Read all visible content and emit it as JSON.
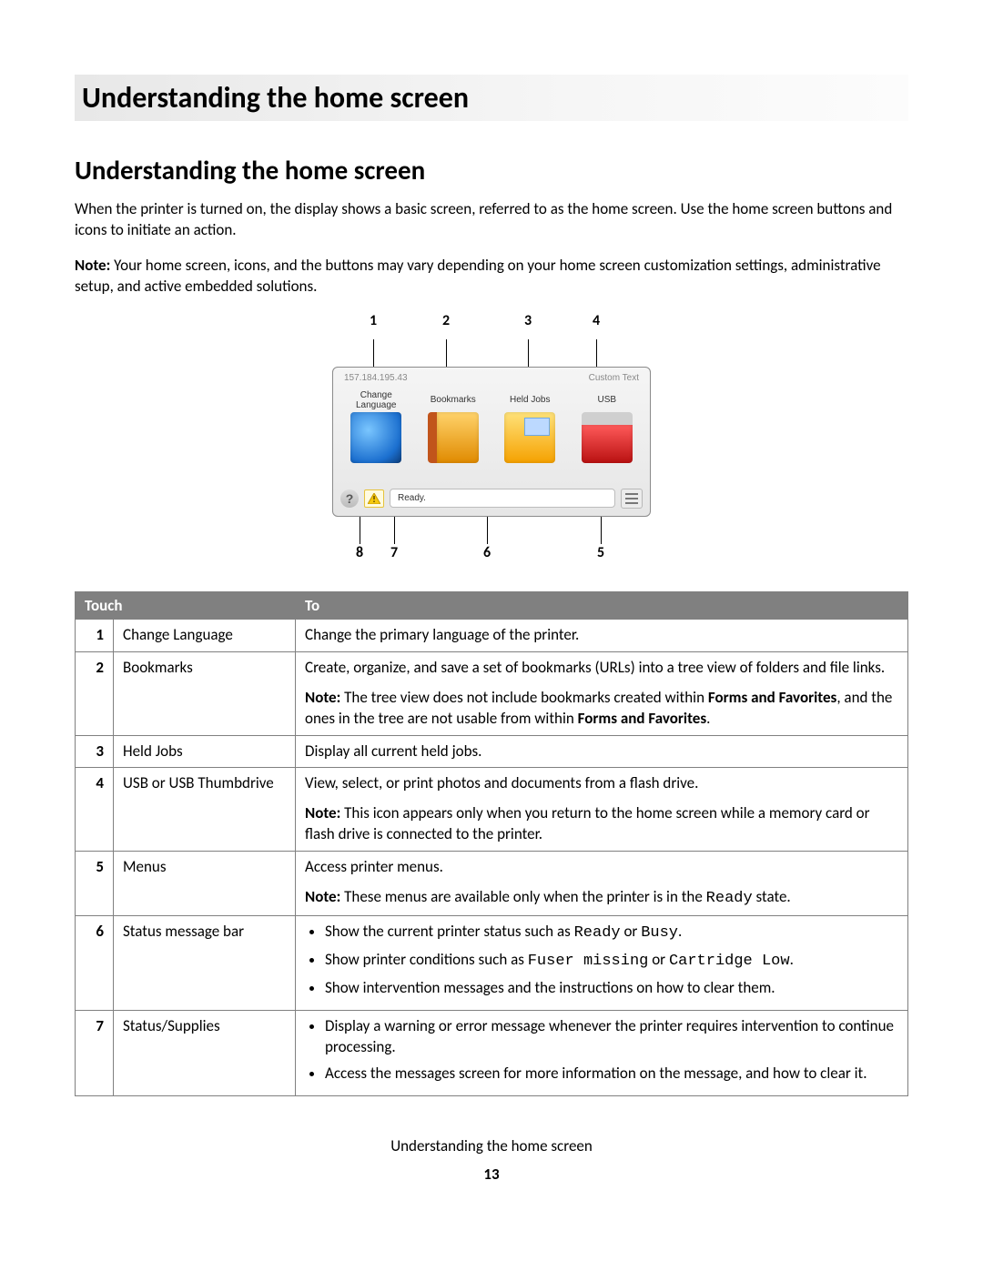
{
  "chapter_title": "Understanding the home screen",
  "section_title": "Understanding the home screen",
  "intro_para": "When the printer is turned on, the display shows a basic screen, referred to as the home screen. Use the home screen buttons and icons to initiate an action.",
  "note_prefix": "Note:",
  "note_para": " Your home screen, icons, and the buttons may vary depending on your home screen customization settings, administrative setup, and active embedded solutions.",
  "callouts_top": {
    "c1": "1",
    "c2": "2",
    "c3": "3",
    "c4": "4"
  },
  "callouts_bot": {
    "c5": "5",
    "c6": "6",
    "c7": "7",
    "c8": "8"
  },
  "device": {
    "ip": "157.184.195.43",
    "custom_text": "Custom Text",
    "items": {
      "change_language": "Change Language",
      "bookmarks": "Bookmarks",
      "held_jobs": "Held Jobs",
      "usb": "USB"
    },
    "status_ready": "Ready.",
    "help_glyph": "?"
  },
  "table": {
    "head_touch": "Touch",
    "head_to": "To",
    "rows": {
      "r1": {
        "num": "1",
        "name": "Change Language",
        "desc": "Change the primary language of the printer."
      },
      "r2": {
        "num": "2",
        "name": "Bookmarks",
        "desc1": "Create, organize, and save a set of bookmarks (URLs) into a tree view of folders and file links.",
        "note_lead": "Note:",
        "note_a": " The tree view does not include bookmarks created within ",
        "ff1": "Forms and Favorites",
        "note_b": ", and the ones in the tree are not usable from within ",
        "ff2": "Forms and Favorites",
        "note_c": "."
      },
      "r3": {
        "num": "3",
        "name": "Held Jobs",
        "desc": "Display all current held jobs."
      },
      "r4": {
        "num": "4",
        "name": "USB or USB Thumbdrive",
        "desc1": "View, select, or print photos and documents from a flash drive.",
        "note_lead": "Note:",
        "note_rest": " This icon appears only when you return to the home screen while a memory card or flash drive is connected to the printer."
      },
      "r5": {
        "num": "5",
        "name": "Menus",
        "desc1": "Access printer menus.",
        "note_lead": "Note:",
        "note_a": " These menus are available only when the printer is in the ",
        "ready": "Ready",
        "note_b": " state."
      },
      "r6": {
        "num": "6",
        "name": "Status message bar",
        "b1a": "Show the current printer status such as ",
        "b1_ready": "Ready",
        "b1_or": " or ",
        "b1_busy": "Busy",
        "b1_end": ".",
        "b2a": "Show printer conditions such as ",
        "b2_fuser": "Fuser missing",
        "b2_or": " or ",
        "b2_cart": "Cartridge Low",
        "b2_end": ".",
        "b3": "Show intervention messages and the instructions on how to clear them."
      },
      "r7": {
        "num": "7",
        "name": "Status/Supplies",
        "b1": "Display a warning or error message whenever the printer requires intervention to continue processing.",
        "b2": "Access the messages screen for more information on the message, and how to clear it."
      }
    }
  },
  "footer": {
    "running": "Understanding the home screen",
    "page": "13"
  }
}
